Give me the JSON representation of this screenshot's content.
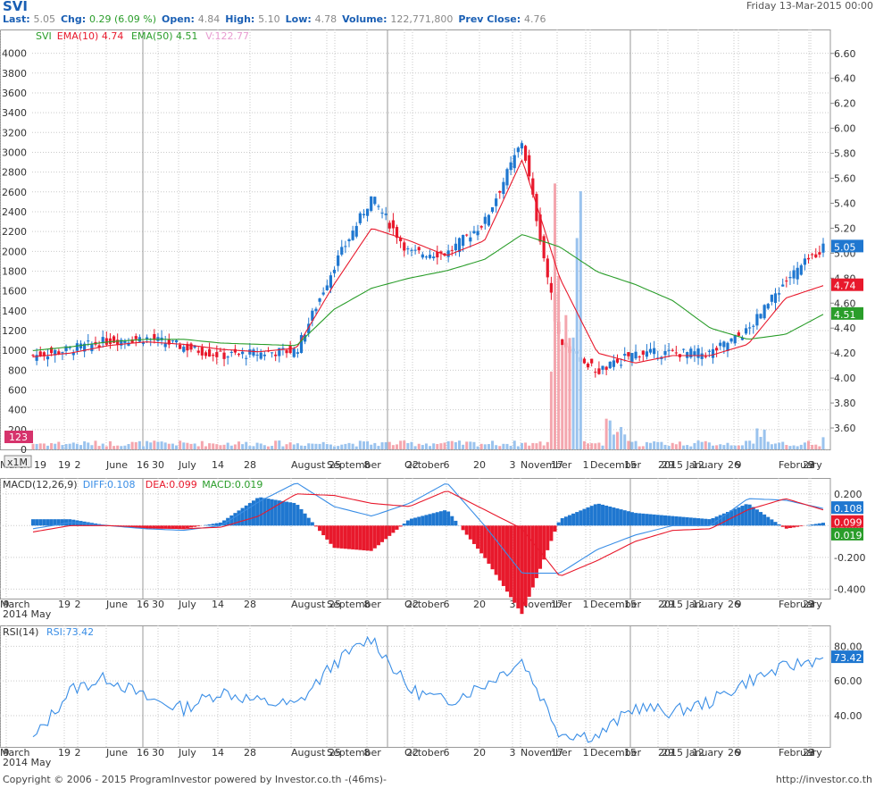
{
  "header": {
    "symbol": "SVI",
    "date": "Friday 13-Mar-2015 00:00",
    "stats": [
      {
        "label": "Last:",
        "value": "5.05",
        "up": false
      },
      {
        "label": "Chg:",
        "value": "0.29 (6.09 %)",
        "up": true
      },
      {
        "label": "Open:",
        "value": "4.84",
        "up": false
      },
      {
        "label": "High:",
        "value": "5.10",
        "up": false
      },
      {
        "label": "Low:",
        "value": "4.78",
        "up": false
      },
      {
        "label": "Volume:",
        "value": "122,771,800",
        "up": false
      },
      {
        "label": "Prev Close:",
        "value": "4.76",
        "up": false
      }
    ]
  },
  "footer": {
    "left": "Copyright © 2006 - 2015 ProgramInvestor powered by Investor.co.th -(46ms)-",
    "right": "http://investor.co.th"
  },
  "colors": {
    "up": "#1f77d0",
    "down": "#e8192c",
    "ema10": "#e8192c",
    "ema50": "#2a9d2a",
    "macd_pos": "#1f77d0",
    "macd_neg": "#e8192c",
    "diff": "#3a8ee6",
    "dea": "#e8192c",
    "rsi": "#3a8ee6",
    "vol_up": "#9ac3ee",
    "vol_down": "#f4a6ae",
    "grid": "#c9c9c9"
  },
  "chart_data": [
    {
      "type": "candlestick",
      "legend": {
        "symbol": "SVI",
        "ema10": "EMA(10) 4.74",
        "ema50": "EMA(50) 4.51",
        "vol": "V:122.77"
      },
      "price_axis": {
        "ticks": [
          "6.60",
          "6.40",
          "6.20",
          "6.00",
          "5.80",
          "5.60",
          "5.40",
          "5.20",
          "5.00",
          "4.80",
          "4.60",
          "4.40",
          "4.20",
          "4.00",
          "3.80",
          "3.60"
        ],
        "range": [
          3.5,
          6.72
        ]
      },
      "volume_axis": {
        "ticks": [
          "4000",
          "3800",
          "3600",
          "3400",
          "3200",
          "3000",
          "2800",
          "2600",
          "2400",
          "2200",
          "2000",
          "1800",
          "1600",
          "1400",
          "1200",
          "1000",
          "800",
          "600",
          "400",
          "200",
          "0"
        ],
        "range": [
          0,
          4150
        ]
      },
      "tags": {
        "last": "5.05",
        "ema10": "4.74",
        "ema50": "4.51",
        "volume": "123",
        "vol_scale": "x1M"
      },
      "x_labels": [
        "19",
        "2",
        "June",
        "16",
        "30",
        "July",
        "14",
        "28",
        "August",
        "25",
        "September",
        "8",
        "22",
        "October",
        "6",
        "20",
        "3",
        "November",
        "17",
        "1",
        "December",
        "15",
        "29",
        "2015 January",
        "12",
        "26",
        "9",
        "February",
        "23",
        "9",
        "March"
      ],
      "anchors": [
        {
          "c": 4.18,
          "ema10": 4.17,
          "ema50": 4.22
        },
        {
          "c": 4.23,
          "ema10": 4.2,
          "ema50": 4.25
        },
        {
          "c": 4.3,
          "ema10": 4.26,
          "ema50": 4.29
        },
        {
          "c": 4.32,
          "ema10": 4.29,
          "ema50": 4.31
        },
        {
          "c": 4.25,
          "ema10": 4.27,
          "ema50": 4.31
        },
        {
          "c": 4.18,
          "ema10": 4.23,
          "ema50": 4.28
        },
        {
          "c": 4.2,
          "ema10": 4.21,
          "ema50": 4.27
        },
        {
          "c": 4.22,
          "ema10": 4.24,
          "ema50": 4.26
        },
        {
          "c": 4.9,
          "ema10": 4.75,
          "ema50": 4.55
        },
        {
          "c": 5.45,
          "ema10": 5.2,
          "ema50": 4.72
        },
        {
          "c": 5.0,
          "ema10": 5.1,
          "ema50": 4.8
        },
        {
          "c": 5.0,
          "ema10": 4.98,
          "ema50": 4.86
        },
        {
          "c": 5.25,
          "ema10": 5.1,
          "ema50": 4.95
        },
        {
          "c": 5.9,
          "ema10": 5.75,
          "ema50": 5.15
        },
        {
          "c": 4.28,
          "ema10": 4.8,
          "ema50": 5.05
        },
        {
          "c": 4.05,
          "ema10": 4.2,
          "ema50": 4.85
        },
        {
          "c": 4.2,
          "ema10": 4.12,
          "ema50": 4.75
        },
        {
          "c": 4.2,
          "ema10": 4.18,
          "ema50": 4.62
        },
        {
          "c": 4.2,
          "ema10": 4.18,
          "ema50": 4.4
        },
        {
          "c": 4.38,
          "ema10": 4.27,
          "ema50": 4.31
        },
        {
          "c": 4.78,
          "ema10": 4.64,
          "ema50": 4.35
        },
        {
          "c": 5.05,
          "ema10": 4.74,
          "ema50": 4.51
        }
      ]
    },
    {
      "type": "bar",
      "legend": {
        "name": "MACD(12,26,9)",
        "diff": "DIFF:0.108",
        "dea": "DEA:0.099",
        "macd": "MACD:0.019"
      },
      "y_ticks": [
        "0.200",
        "0.000",
        "-0.200",
        "-0.400"
      ],
      "y_range": [
        -0.46,
        0.3
      ],
      "tags": {
        "diff": "0.108",
        "dea": "0.099",
        "macd": "0.019"
      },
      "x_labels": [
        "9",
        "19",
        "2",
        "June",
        "16",
        "30",
        "July",
        "14",
        "28",
        "August",
        "25",
        "September",
        "8",
        "22",
        "October",
        "6",
        "20",
        "3",
        "November",
        "17",
        "1",
        "December",
        "15",
        "29",
        "2015 January",
        "12",
        "26",
        "9",
        "February",
        "23",
        "9",
        "March"
      ],
      "secondary_x_labels": [
        "2014 May"
      ],
      "anchors": [
        {
          "diff": -0.02,
          "dea": -0.04
        },
        {
          "diff": 0.02,
          "dea": 0.0
        },
        {
          "diff": 0.0,
          "dea": 0.0
        },
        {
          "diff": -0.02,
          "dea": -0.01
        },
        {
          "diff": -0.03,
          "dea": -0.02
        },
        {
          "diff": 0.0,
          "dea": -0.01
        },
        {
          "diff": 0.15,
          "dea": 0.06
        },
        {
          "diff": 0.27,
          "dea": 0.2
        },
        {
          "diff": 0.12,
          "dea": 0.19
        },
        {
          "diff": 0.06,
          "dea": 0.14
        },
        {
          "diff": 0.14,
          "dea": 0.12
        },
        {
          "diff": 0.27,
          "dea": 0.22
        },
        {
          "diff": 0.0,
          "dea": 0.1
        },
        {
          "diff": -0.3,
          "dea": -0.02
        },
        {
          "diff": -0.3,
          "dea": -0.32
        },
        {
          "diff": -0.15,
          "dea": -0.22
        },
        {
          "diff": -0.06,
          "dea": -0.1
        },
        {
          "diff": 0.0,
          "dea": -0.03
        },
        {
          "diff": 0.0,
          "dea": -0.02
        },
        {
          "diff": 0.17,
          "dea": 0.1
        },
        {
          "diff": 0.16,
          "dea": 0.17
        },
        {
          "diff": 0.108,
          "dea": 0.099
        }
      ]
    },
    {
      "type": "line",
      "legend": {
        "name": "RSI(14)",
        "value": "RSI:73.42"
      },
      "y_ticks": [
        "80.00",
        "60.00",
        "40.00"
      ],
      "y_range": [
        22,
        92
      ],
      "tags": {
        "rsi": "73.42"
      },
      "x_labels": [
        "9",
        "19",
        "2",
        "June",
        "16",
        "30",
        "July",
        "14",
        "28",
        "August",
        "25",
        "September",
        "8",
        "22",
        "October",
        "6",
        "20",
        "3",
        "November",
        "17",
        "1",
        "December",
        "15",
        "29",
        "2015 January",
        "12",
        "26",
        "9",
        "February",
        "23",
        "9",
        "March"
      ],
      "secondary_x_labels": [
        "2014 May"
      ],
      "anchors": [
        26,
        55,
        62,
        50,
        44,
        54,
        48,
        46,
        70,
        85,
        55,
        48,
        58,
        72,
        30,
        28,
        45,
        42,
        48,
        60,
        68,
        73.42
      ]
    }
  ]
}
